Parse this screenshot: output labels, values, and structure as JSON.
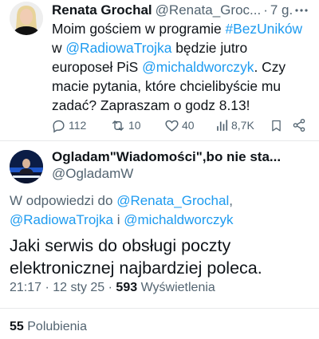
{
  "tweet1": {
    "author_name": "Renata Grochal",
    "author_handle": "@Renata_Groc...",
    "separator": "·",
    "age": "7 g.",
    "body": {
      "line1_a": "Moim gościem w programie ",
      "line1_tag": "#BezUników",
      "line2_a": "w ",
      "line2_mention": "@RadiowaTrojka",
      "line2_b": " będzie jutro",
      "line3_a": "europoseł PiS ",
      "line3_mention": "@michaldworczyk",
      "line3_b": ". Czy",
      "line4": "macie pytania, które chcielibyście mu",
      "line5": "zadać? Zapraszam o godz 8.13!"
    },
    "actions": {
      "replies": "112",
      "reposts": "10",
      "likes": "40",
      "views": "8,7K"
    }
  },
  "tweet2": {
    "author_name": "Ogladam\"Wiadomości\",bo nie sta...",
    "author_handle": "@OgladamW",
    "reply_prefix": "W odpowiedzi do ",
    "reply_mention1": "@Renata_Grochal",
    "reply_comma": ",",
    "reply_mention2": "@RadiowaTrojka",
    "reply_and": " i ",
    "reply_mention3": "@michaldworczyk",
    "body_line1": "Jaki serwis do obsługi poczty",
    "body_line2": "elektronicznej najbardziej poleca.",
    "time": "21:17",
    "date": "12 sty 25",
    "meta_sep": " · ",
    "views_count": "593",
    "views_label": " Wyświetlenia",
    "likes_count": "55",
    "likes_label": " Polubienia"
  },
  "colors": {
    "accent": "#1d9bf0",
    "muted": "#536471",
    "text": "#0f1419",
    "divider": "#e7e9ea"
  },
  "icons": [
    "reply-icon",
    "repost-icon",
    "like-icon",
    "views-icon",
    "bookmark-icon",
    "share-icon",
    "more-icon"
  ]
}
